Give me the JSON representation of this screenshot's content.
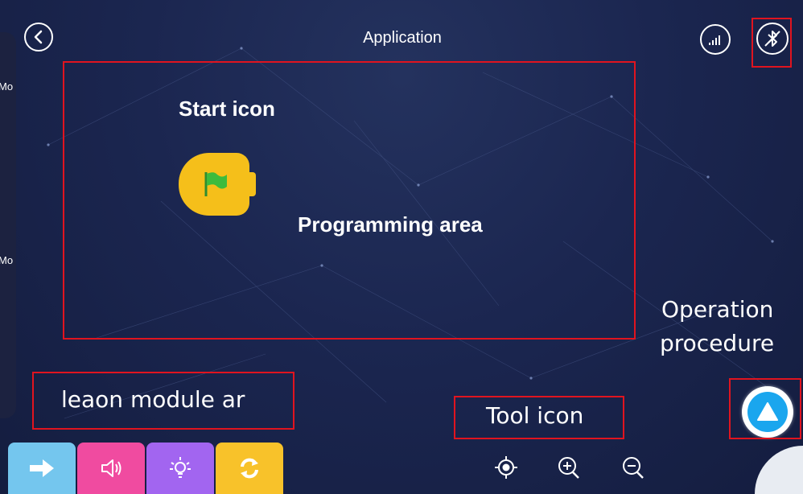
{
  "header": {
    "title": "Application",
    "back_icon": "chevron-left-icon",
    "signal_icon": "signal-strength-icon",
    "bluetooth_icon": "bluetooth-off-icon"
  },
  "left_panel": {
    "items": [
      {
        "label": "Mo"
      },
      {
        "label": "Mo"
      }
    ]
  },
  "annotations": {
    "start_icon": "Start icon",
    "programming_area": "Programming area",
    "operation_line1": "Operation",
    "operation_line2": "procedure",
    "lesson_module": "leaon module ar",
    "tool_icon": "Tool icon"
  },
  "start_block": {
    "icon": "green-flag-icon",
    "color": "#f5bf1a"
  },
  "module_tabs": [
    {
      "name": "motion",
      "icon": "arrow-right-icon",
      "color": "#74c6ee"
    },
    {
      "name": "sound",
      "icon": "speaker-icon",
      "color": "#f04ba0"
    },
    {
      "name": "light",
      "icon": "lightbulb-icon",
      "color": "#a265f0"
    },
    {
      "name": "control",
      "icon": "loop-icon",
      "color": "#f8c22a"
    }
  ],
  "tools": [
    {
      "name": "center",
      "icon": "locate-icon"
    },
    {
      "name": "zoom-in",
      "icon": "zoom-in-icon"
    },
    {
      "name": "zoom-out",
      "icon": "zoom-out-icon"
    }
  ],
  "run_button": {
    "icon": "triangle-up-icon",
    "color": "#1aa6ee"
  },
  "colors": {
    "background": "#1b2650",
    "highlight_box": "#e0141f",
    "text": "#ffffff"
  }
}
